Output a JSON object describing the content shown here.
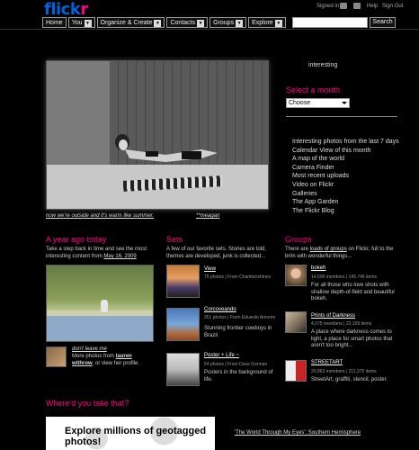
{
  "header": {
    "logo_part1": "flick",
    "logo_part2": "r",
    "signed_in": "Signed in as",
    "help": "Help",
    "sign_out": "Sign Out",
    "nav": [
      {
        "label": "Home",
        "dropdown": false
      },
      {
        "label": "You",
        "dropdown": true
      },
      {
        "label": "Organize & Create",
        "dropdown": true
      },
      {
        "label": "Contacts",
        "dropdown": true
      },
      {
        "label": "Groups",
        "dropdown": true
      },
      {
        "label": "Explore",
        "dropdown": true
      }
    ],
    "search_value": "",
    "search_button": "Search"
  },
  "hero": {
    "caption": "now we're outside and it's warm like summer.",
    "credit": "**meagan"
  },
  "sidebar": {
    "interesting": "interesting",
    "select_month_heading": "Select a month",
    "month_selected": "Choose",
    "links": [
      "Interesting photos from the last 7 days",
      "Calendar View of this month",
      "A map of the world",
      "Camera Finder",
      "Most recent uploads",
      "Video on Flickr",
      "Galleries",
      "The App Garden",
      "The Flickr Blog"
    ]
  },
  "year_ago": {
    "heading": "A year ago today",
    "intro": "Take a step back in time and see the most interesting content from",
    "date": "May 16, 2009",
    "photo_title": "don't leave me",
    "more_text_1": "More photos from",
    "more_user": "lauren withrow",
    "more_text_2": ", or view her profile."
  },
  "sets": {
    "heading": "Sets",
    "intro": "A few of our favorite sets. Stories are told, themes are developed, junk is collected...",
    "items": [
      {
        "title": "View",
        "meta": "75 photos | From Chambershines",
        "desc": ""
      },
      {
        "title": "Corcoveando",
        "meta": "351 photos | From Eduardo Amorim",
        "desc": "Stunning frontier cowboys in Brazil"
      },
      {
        "title": "Poster + Life ~",
        "meta": "54 photos | From Dave Gorman",
        "desc": "Posters in the background of life."
      }
    ]
  },
  "groups": {
    "heading": "Groups",
    "intro_1": "There are",
    "intro_link": "loads of groups",
    "intro_2": "on Flickr, full to the brim with wonderful things...",
    "items": [
      {
        "title": "bokeh",
        "meta": "14,506 members | 145,746 items",
        "desc": "For all those who love shots with shallow depth-of-field and beautiful bokeh."
      },
      {
        "title": "Prints of Darkness",
        "meta": "4,075 members | 22,109 items",
        "desc": "A place where darkness comes to light, a place for smart photos that aren't too bright..."
      },
      {
        "title": "STREETART",
        "meta": "20,863 members | 211,375 items",
        "desc": "StreetArt, graffiti, stencil, poster."
      }
    ]
  },
  "where": {
    "heading": "Where'd you take that?",
    "map_text": "Explore millions of geotagged photos!",
    "side_link": "'The World Through My Eyes': Southern Hemisphere"
  }
}
